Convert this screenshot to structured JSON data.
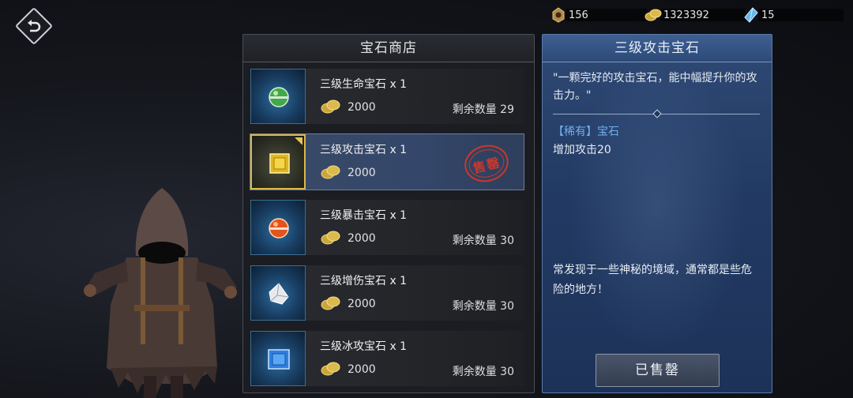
{
  "currencies": [
    {
      "name": "soul-token-icon",
      "value": "156"
    },
    {
      "name": "gold-coin-icon",
      "value": "1323392"
    },
    {
      "name": "blue-crystal-icon",
      "value": "15"
    }
  ],
  "shop": {
    "title": "宝石商店",
    "items": [
      {
        "name": "三级生命宝石 x 1",
        "price": "2000",
        "remain": "剩余数量 29",
        "gem": "green-gem-icon"
      },
      {
        "name": "三级攻击宝石 x 1",
        "price": "2000",
        "sold_stamp": "售罄",
        "gem": "yellow-gem-icon"
      },
      {
        "name": "三级暴击宝石 x 1",
        "price": "2000",
        "remain": "剩余数量 30",
        "gem": "red-gem-icon"
      },
      {
        "name": "三级增伤宝石 x 1",
        "price": "2000",
        "remain": "剩余数量 30",
        "gem": "white-gem-icon"
      },
      {
        "name": "三级冰攻宝石 x 1",
        "price": "2000",
        "remain": "剩余数量 30",
        "gem": "blue-gem-icon"
      }
    ]
  },
  "detail": {
    "title": "三级攻击宝石",
    "description": "\"一颗完好的攻击宝石，能中幅提升你的攻击力。\"",
    "rarity": "【稀有】宝石",
    "effect": "增加攻击20",
    "lore": "常发现于一些神秘的境域，通常都是些危险的地方！",
    "button_label": "已售罄"
  },
  "colors": {
    "selected_item": "#34476a",
    "rarity_text": "#6fb0f0",
    "stamp": "#c8382c",
    "detail_panel": "#223a63"
  }
}
